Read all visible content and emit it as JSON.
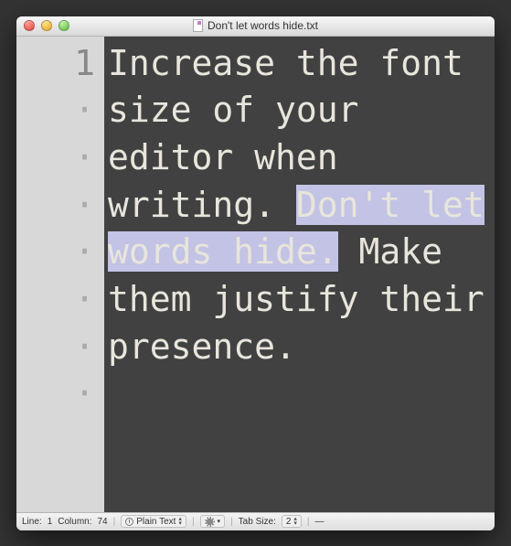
{
  "window": {
    "title": "Don't let words hide.txt"
  },
  "editor": {
    "line_number": "1",
    "wrap_marker": "·",
    "wrap_count": 7,
    "text_before": "Increase the font size of your editor when writing. ",
    "text_selected": "Don't let words hide.",
    "text_after": " Make them justify their presence."
  },
  "status": {
    "line_label": "Line:",
    "line_value": "1",
    "column_label": "Column:",
    "column_value": "74",
    "syntax_mode": "Plain Text",
    "tab_label": "Tab Size:",
    "tab_value": "2",
    "extra": "—"
  }
}
